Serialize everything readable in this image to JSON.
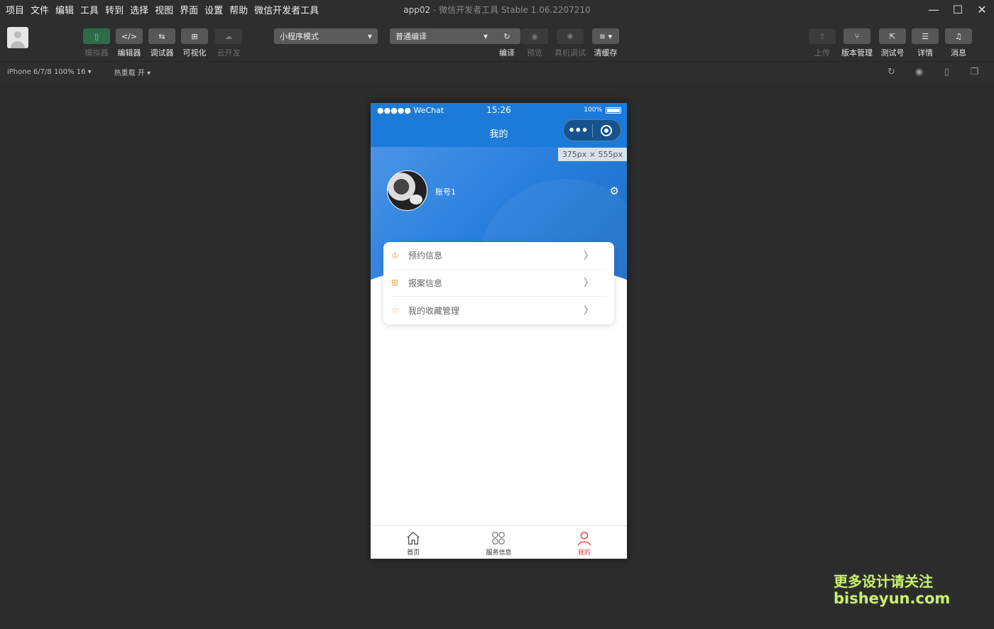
{
  "menu": [
    "项目",
    "文件",
    "编辑",
    "工具",
    "转到",
    "选择",
    "视图",
    "界面",
    "设置",
    "帮助",
    "微信开发者工具"
  ],
  "app_title": "app02",
  "app_subtitle": " - 微信开发者工具 Stable 1.06.2207210",
  "toolbar": {
    "simulator": "模拟器",
    "editor": "编辑器",
    "debugger": "调试器",
    "visual": "可视化",
    "cloud": "云开发",
    "mode_select": "小程序模式",
    "compile_select": "普通编译",
    "compile": "编译",
    "preview": "预览",
    "remote_debug": "真机调试",
    "clear_cache": "清缓存",
    "upload": "上传",
    "version": "版本管理",
    "test_account": "测试号",
    "details": "详情",
    "messages": "消息"
  },
  "subbar": {
    "device": "iPhone 6/7/8 100% 16 ▾",
    "hot_reload": "热重载 开 ▾"
  },
  "phone": {
    "status_left": "●●●●● WeChat",
    "time": "15:26",
    "battery": "100%",
    "nav_title": "我的",
    "size_tip": "375px × 555px",
    "username": "账号1",
    "items": [
      {
        "icon": "shirt-icon",
        "label": "预约信息"
      },
      {
        "icon": "grid-icon",
        "label": "报案信息"
      },
      {
        "icon": "star-icon",
        "label": "我的收藏管理"
      }
    ],
    "tabs": [
      {
        "label": "首页",
        "active": false
      },
      {
        "label": "服务信息",
        "active": false
      },
      {
        "label": "我的",
        "active": true
      }
    ]
  },
  "watermark": {
    "line1": "更多设计请关注",
    "line2": "bisheyun.com"
  },
  "colors": {
    "accent": "#1c7bd8",
    "tab_active": "#e23838",
    "icon_orange": "#e0a74a"
  }
}
